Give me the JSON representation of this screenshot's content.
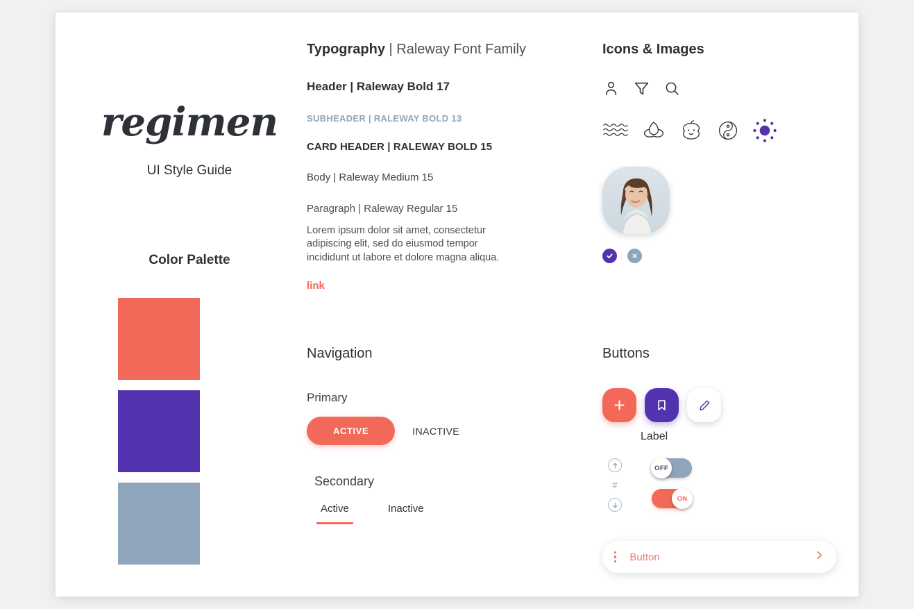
{
  "brand": {
    "logo": "regimen",
    "subtitle": "UI Style Guide"
  },
  "palette": {
    "title": "Color Palette",
    "swatches": [
      {
        "name": "coral",
        "hex": "#F2695A"
      },
      {
        "name": "purple",
        "hex": "#5232AF"
      },
      {
        "name": "slate",
        "hex": "#8EA5BC"
      }
    ]
  },
  "typography": {
    "title": "Typography",
    "title_suffix": " | Raleway Font Family",
    "header": "Header | Raleway Bold 17",
    "subheader": "SUBHEADER | RALEWAY BOLD 13",
    "card_header": "CARD HEADER | RALEWAY BOLD 15",
    "body": "Body | Raleway Medium 15",
    "paragraph_label": "Paragraph | Raleway Regular 15",
    "paragraph": "Lorem ipsum dolor sit amet, consectetur adipiscing elit, sed do eiusmod tempor incididunt ut labore et dolore magna aliqua.",
    "link": "link"
  },
  "icons_section": {
    "title": "Icons & Images",
    "row1": [
      "person-icon",
      "filter-icon",
      "search-icon"
    ],
    "row2": [
      "waves-icon",
      "lotus-icon",
      "baby-face-icon",
      "yin-yang-icon",
      "sun-radial-icon"
    ],
    "avatar": "avatar-photo",
    "badges": [
      "check-badge",
      "close-badge"
    ]
  },
  "navigation": {
    "title": "Navigation",
    "primary_label": "Primary",
    "primary_active": "ACTIVE",
    "primary_inactive": "INACTIVE",
    "secondary_label": "Secondary",
    "secondary_active": "Active",
    "secondary_inactive": "Inactive"
  },
  "buttons": {
    "title": "Buttons",
    "fab_add": "+",
    "fab_bookmark": "bookmark-icon",
    "fab_edit": "pencil-icon",
    "fab_label": "Label",
    "stepper_value": "#",
    "toggle_off": "OFF",
    "toggle_on": "ON",
    "wide_button_label": "Button"
  }
}
